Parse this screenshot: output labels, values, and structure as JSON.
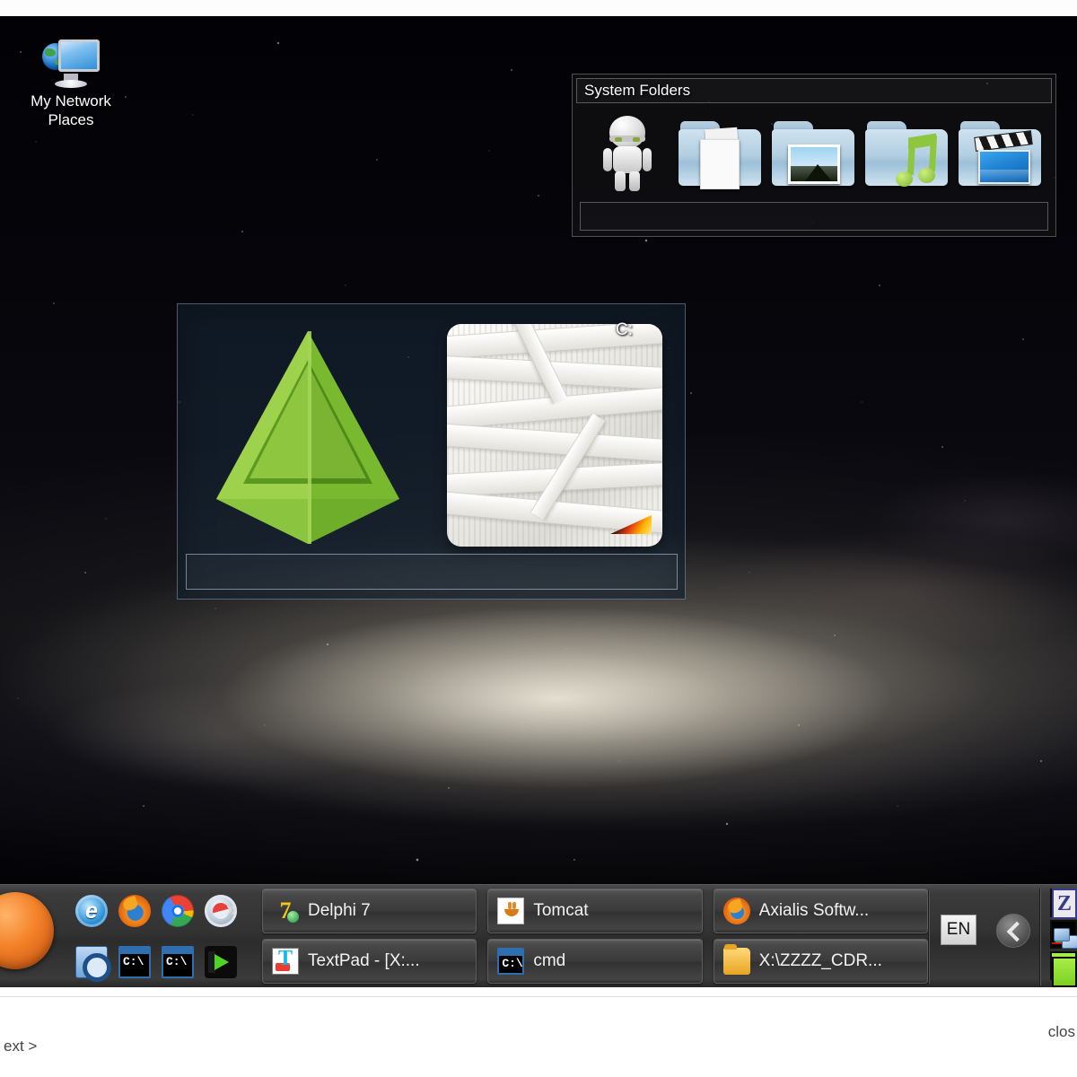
{
  "desktop": {
    "icons": [
      {
        "name": "my-network-places",
        "label": "My Network\nPlaces",
        "label_line1": "My Network",
        "label_line2": "Places",
        "icon": "network-computer-icon"
      }
    ],
    "wallpaper": "milky-way-galaxy-starfield",
    "background_color": "#050509"
  },
  "system_folders_panel": {
    "title": "System Folders",
    "items": [
      {
        "label": "",
        "icon": "astronaut-robot-icon"
      },
      {
        "label": "",
        "icon": "documents-folder-icon"
      },
      {
        "label": "",
        "icon": "pictures-folder-icon"
      },
      {
        "label": "",
        "icon": "music-folder-icon"
      },
      {
        "label": "",
        "icon": "videos-folder-icon"
      }
    ]
  },
  "drives_panel": {
    "items": [
      {
        "label": "",
        "icon": "green-tetrahedron-icon"
      },
      {
        "label": "C:",
        "icon": "wrapped-drive-icon"
      }
    ]
  },
  "taskbar": {
    "start_button": {
      "label": "",
      "icon": "start-orb-icon"
    },
    "quick_launch": {
      "overflow_label": "»",
      "row1": [
        {
          "label": "",
          "icon": "internet-explorer-icon"
        },
        {
          "label": "",
          "icon": "firefox-icon"
        },
        {
          "label": "",
          "icon": "chrome-icon"
        },
        {
          "label": "",
          "icon": "safari-icon"
        }
      ],
      "row2": [
        {
          "label": "",
          "icon": "outlook-express-icon"
        },
        {
          "label": "",
          "icon": "command-prompt-icon"
        },
        {
          "label": "",
          "icon": "command-prompt-icon"
        },
        {
          "label": "",
          "icon": "media-player-icon"
        }
      ]
    },
    "task_buttons": [
      {
        "label": "Delphi 7",
        "icon": "delphi-icon"
      },
      {
        "label": "Tomcat",
        "icon": "java-tomcat-icon"
      },
      {
        "label": "Axialis Softw...",
        "icon": "firefox-icon"
      },
      {
        "label": "TextPad - [X:...",
        "icon": "textpad-icon"
      },
      {
        "label": "cmd",
        "icon": "command-prompt-icon"
      },
      {
        "label": "X:\\ZZZZ_CDR...",
        "icon": "folder-icon"
      }
    ],
    "tray": {
      "language": "EN",
      "expand_icon": "chevron-left-icon",
      "widgets": [
        {
          "label": "",
          "icon": "green-indicator-icon"
        },
        {
          "label": "",
          "icon": "cpu-graph-icon"
        },
        {
          "label": "",
          "icon": "green-indicator-icon"
        }
      ],
      "far_widgets": [
        {
          "label": "Z",
          "icon": "zoom-app-icon"
        },
        {
          "label": "",
          "icon": "network-connection-icon"
        }
      ]
    }
  },
  "bottom_dialog": {
    "next_label": "ext >",
    "close_label": "clos"
  }
}
